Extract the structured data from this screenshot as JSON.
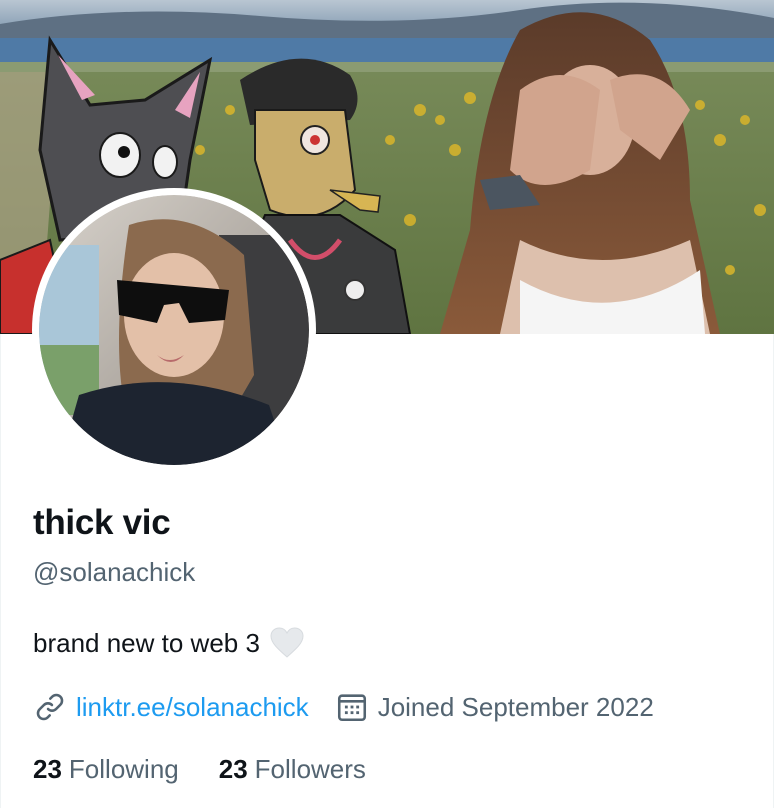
{
  "profile": {
    "display_name": "thick vic",
    "handle": "@solanachick",
    "bio": "brand new to web 3",
    "bio_emoji": "white-heart-icon",
    "link": "linktr.ee/solanachick",
    "joined": "Joined September 2022",
    "following_count": "23",
    "following_label": "Following",
    "followers_count": "23",
    "followers_label": "Followers"
  },
  "colors": {
    "accent": "#1d9bf0",
    "secondary_text": "#536471",
    "primary_text": "#0f1419"
  },
  "icons": {
    "link": "link-icon",
    "calendar": "calendar-icon"
  }
}
